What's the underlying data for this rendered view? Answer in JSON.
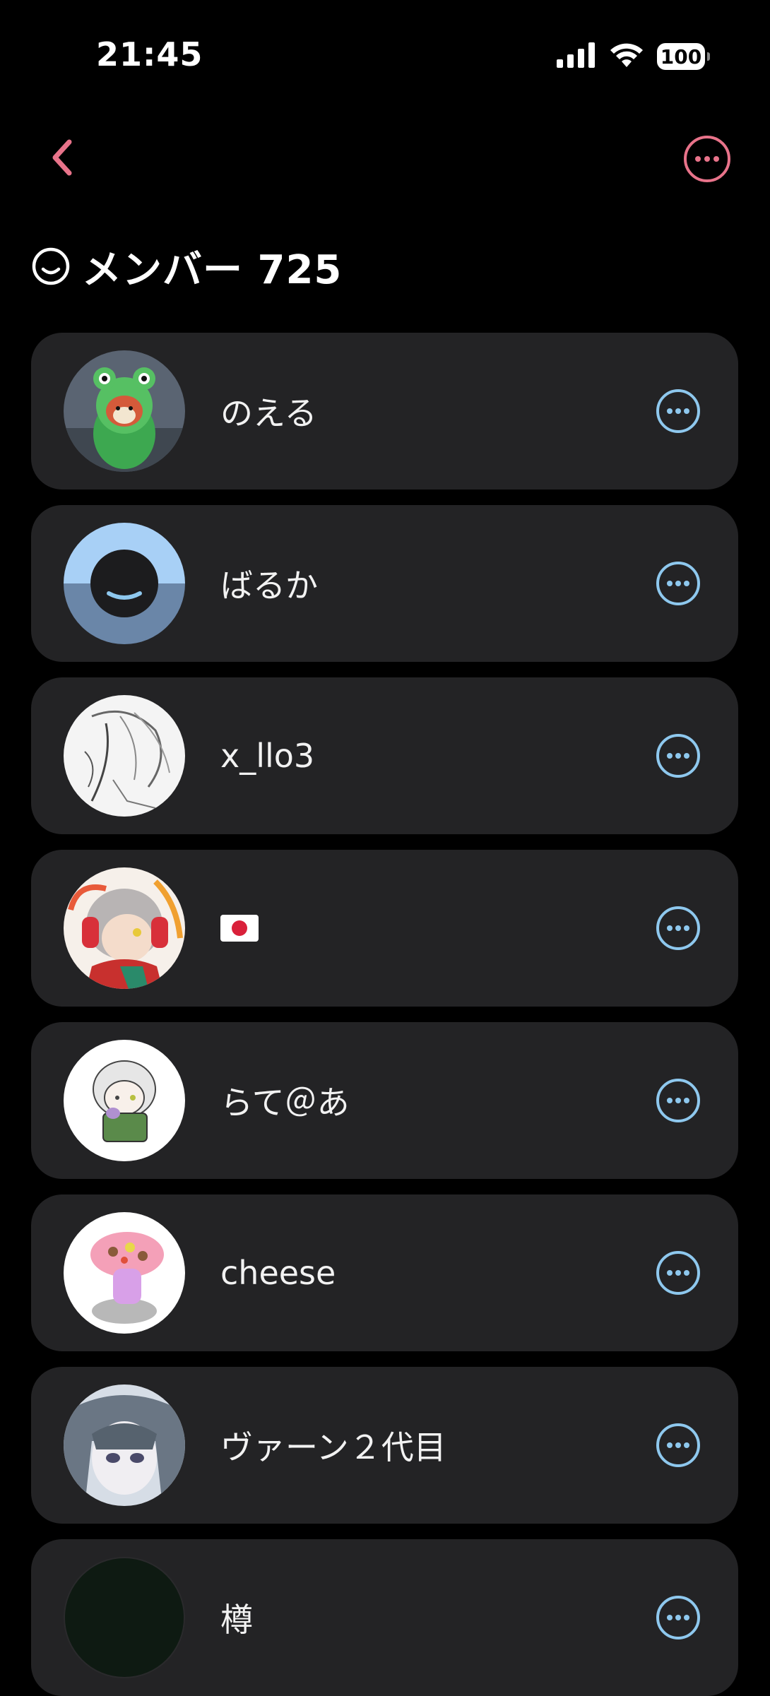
{
  "status_bar": {
    "time": "21:45",
    "battery": "100",
    "icons": [
      "cellular-signal-icon",
      "wifi-icon",
      "battery-icon"
    ]
  },
  "nav": {
    "back_icon": "chevron-left-icon",
    "more_icon": "ellipsis-circle-icon",
    "accent_color": "#e8738a"
  },
  "header": {
    "title": "メンバー 725",
    "icon": "smiley-face-icon"
  },
  "members": [
    {
      "name": "のえる",
      "avatar": "frog-costume-character"
    },
    {
      "name": "ばるか",
      "avatar": "default-blue-smiley"
    },
    {
      "name": "x_llo3",
      "avatar": "sketch-portrait"
    },
    {
      "name": "",
      "avatar": "headphones-character",
      "name_icon": "japan-flag-icon"
    },
    {
      "name": "らて＠あ",
      "avatar": "chibi-character"
    },
    {
      "name": "cheese",
      "avatar": "pink-drawing"
    },
    {
      "name": "ヴァーン２代目",
      "avatar": "anime-girl-portrait"
    },
    {
      "name": "樽",
      "avatar": "dark-green"
    }
  ],
  "colors": {
    "background": "#000000",
    "row_background": "#232325",
    "row_more_icon": "#8ec8ee",
    "text": "#f2f2f2"
  }
}
